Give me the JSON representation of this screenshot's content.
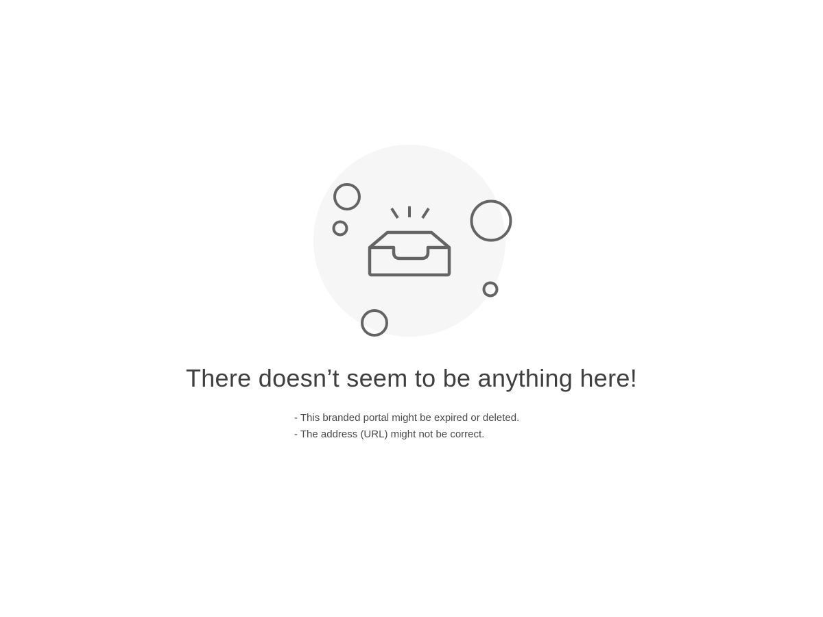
{
  "empty_state": {
    "illustration_icon": "empty-inbox-tray-icon",
    "title": "There doesn’t seem to be anything here!",
    "reasons": [
      "- This branded portal might be expired or deleted.",
      "- The address (URL) might not be correct."
    ]
  },
  "colors": {
    "background": "#ffffff",
    "illustration_circle": "#f6f6f6",
    "icon_stroke": "#646464",
    "title_text": "#3f3f3f",
    "body_text": "#4a4a4a"
  }
}
